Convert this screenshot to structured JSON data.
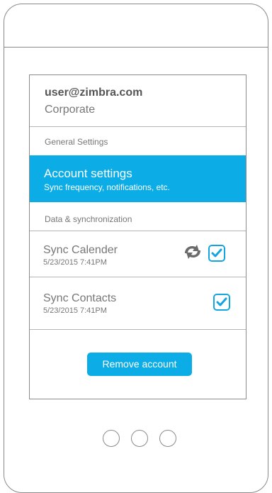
{
  "account": {
    "email": "user@zimbra.com",
    "type": "Corporate"
  },
  "sections": {
    "general": "General Settings",
    "data_sync": "Data & synchronization"
  },
  "account_settings": {
    "title": "Account settings",
    "subtitle": "Sync frequency, notifications, etc."
  },
  "sync_items": [
    {
      "title": "Sync Calender",
      "timestamp": "5/23/2015 7:41PM",
      "checked": true,
      "icon": "sync-icon"
    },
    {
      "title": "Sync Contacts",
      "timestamp": "5/23/2015 7:41PM",
      "checked": true
    }
  ],
  "remove_button": {
    "label": "Remove account"
  },
  "colors": {
    "accent": "#0cade6",
    "text": "#777777",
    "border": "#8a8a8a"
  }
}
